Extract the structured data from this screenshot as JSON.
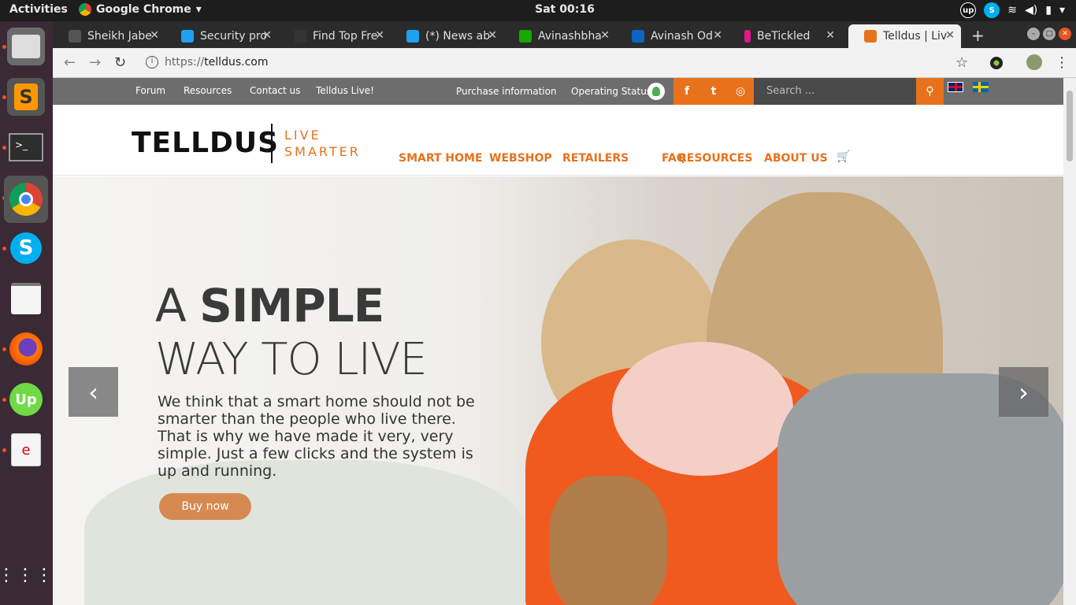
{
  "system": {
    "activities": "Activities",
    "app_name": "Google Chrome",
    "clock": "Sat 00:16"
  },
  "tabs": [
    {
      "title": "Sheikh Jabe",
      "color": "#555555"
    },
    {
      "title": "Security pro",
      "color": "#1da1f2"
    },
    {
      "title": "Find Top Fre",
      "color": "#333333"
    },
    {
      "title": "(*) News ab",
      "color": "#1da1f2"
    },
    {
      "title": "Avinashbha",
      "color": "#14a800"
    },
    {
      "title": "Avinash Od",
      "color": "#0a66c2"
    },
    {
      "title": "BeTickled",
      "color": "#e4168c"
    },
    {
      "title": "Telldus | Liv",
      "color": "#e8721c"
    }
  ],
  "browser": {
    "url_proto": "https://",
    "url_host": "telldus.com"
  },
  "site": {
    "util_links": [
      "Forum",
      "Resources",
      "Contact us",
      "Telldus Live!"
    ],
    "purchase": "Purchase information",
    "operating_status": "Operating Status",
    "search_placeholder": "Search ...",
    "logo": "TELLDUS",
    "tagline1": "LIVE",
    "tagline2": "SMARTER",
    "nav": [
      "SMART HOME",
      "WEBSHOP",
      "RETAILERS",
      "FAQ",
      "RESOURCES",
      "ABOUT US"
    ],
    "hero_a": "A",
    "hero_simple": "SIMPLE",
    "hero_line2": "WAY TO LIVE",
    "hero_text": "We think that a smart home should not be smarter than the people who live there. That is why we have made it very, very simple. Just a few clicks and the system is up and running.",
    "buy_now": "Buy now"
  },
  "colors": {
    "accent": "#e8721c",
    "utilbar": "#6d6d6d"
  }
}
